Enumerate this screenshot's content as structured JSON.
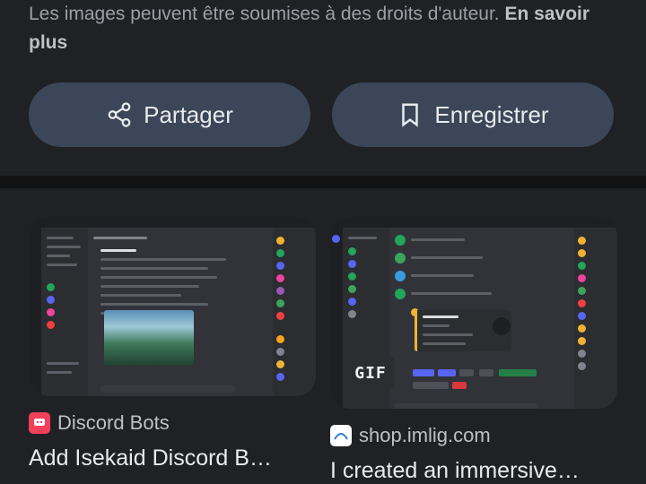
{
  "notice": {
    "text": "Les images peuvent être soumises à des droits d'auteur.",
    "link": "En savoir plus"
  },
  "actions": {
    "share_label": "Partager",
    "save_label": "Enregistrer",
    "share_icon": "share-icon",
    "save_icon": "bookmark-icon"
  },
  "results": [
    {
      "source": "Discord Bots",
      "title": "Add Isekaid Discord B…",
      "favicon_color": "#f23f5a"
    },
    {
      "source": "shop.imlig.com",
      "title": "I created an immersive…",
      "favicon_color": "#ffffff",
      "badge": "GIF"
    }
  ],
  "colors": {
    "background": "#202124",
    "button": "#3b4658",
    "text": "#e8eaed",
    "muted": "#9aa0a6"
  }
}
